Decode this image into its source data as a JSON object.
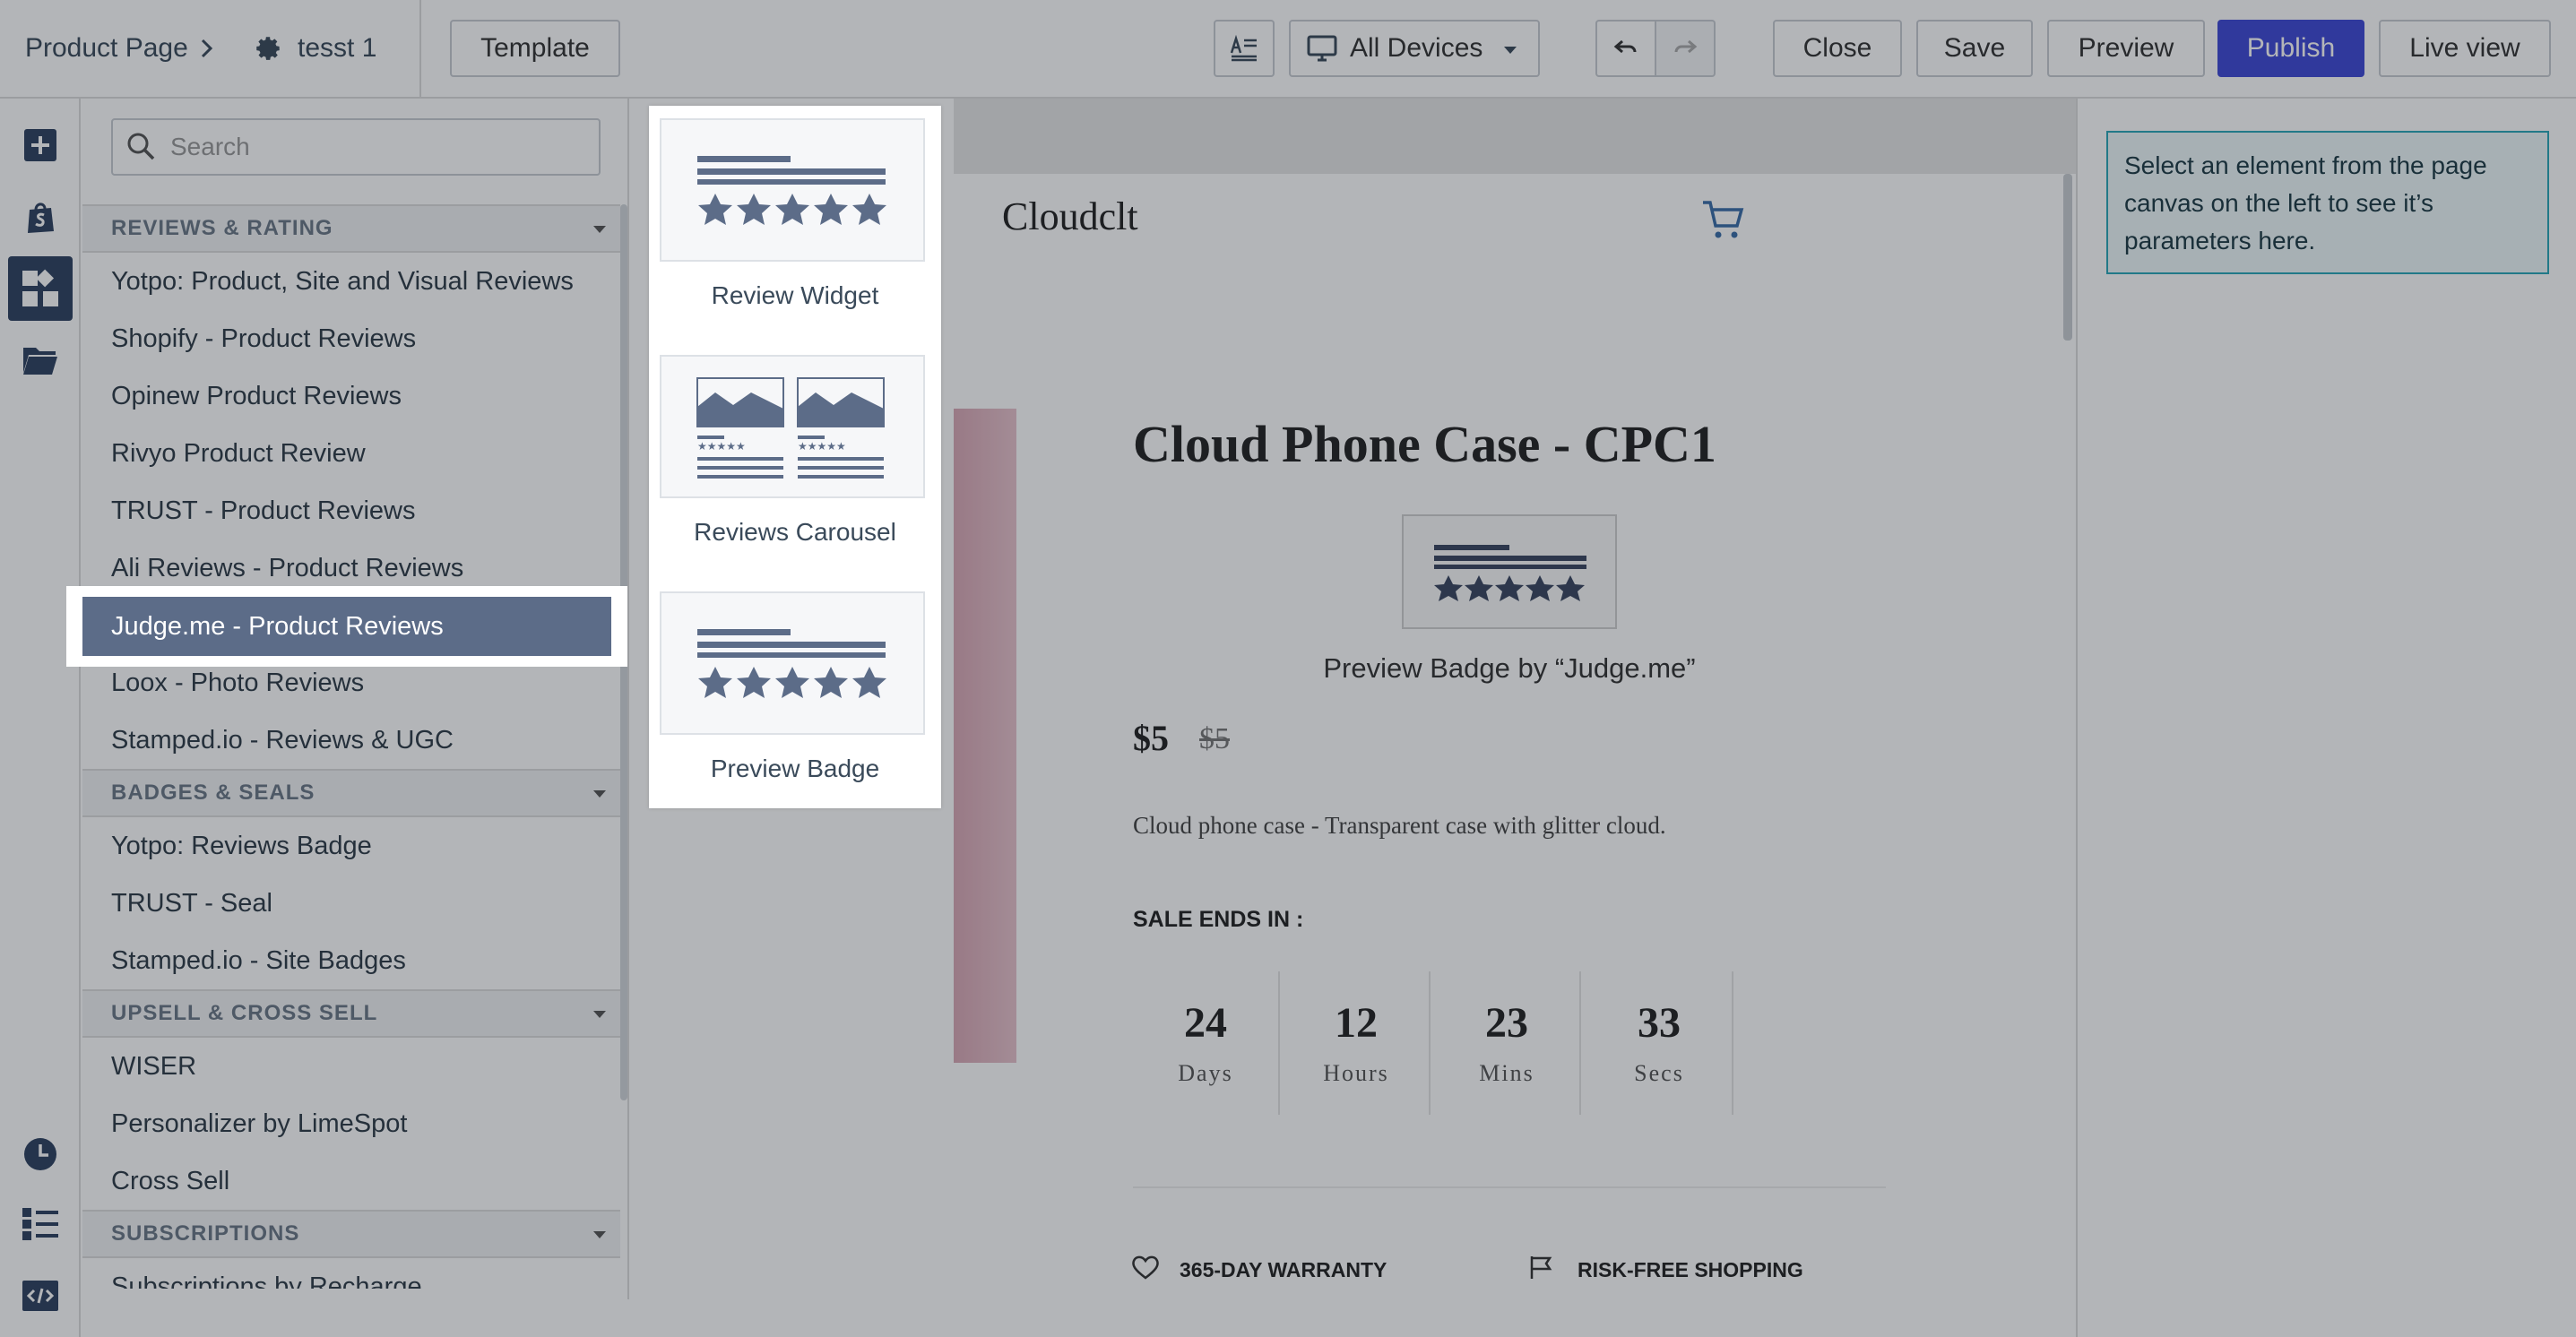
{
  "topbar": {
    "breadcrumb_root": "Product Page",
    "page_name": "tesst 1",
    "template_label": "Template",
    "devices_label": "All Devices",
    "close_label": "Close",
    "save_label": "Save",
    "preview_label": "Preview",
    "publish_label": "Publish",
    "liveview_label": "Live view"
  },
  "search": {
    "placeholder": "Search"
  },
  "sections": {
    "reviews": "REVIEWS & RATING",
    "badges": "BADGES & SEALS",
    "upsell": "UPSELL & CROSS SELL",
    "subs": "SUBSCRIPTIONS"
  },
  "reviews_items": [
    "Yotpo: Product, Site and Visual Reviews",
    "Shopify - Product Reviews",
    "Opinew Product Reviews",
    "Rivyo Product Review",
    "TRUST - Product Reviews",
    "Ali Reviews - Product Reviews",
    "Judge.me - Product Reviews",
    "Loox - Photo Reviews",
    "Stamped.io - Reviews & UGC"
  ],
  "badges_items": [
    "Yotpo: Reviews Badge",
    "TRUST - Seal",
    "Stamped.io - Site Badges"
  ],
  "upsell_items": [
    "WISER",
    "Personalizer by LimeSpot",
    "Cross Sell"
  ],
  "subs_items": [
    "Subscriptions by Recharge"
  ],
  "widgets": [
    "Review Widget",
    "Reviews Carousel",
    "Preview Badge"
  ],
  "canvas": {
    "store_name": "Cloudclt",
    "product_title": "Cloud Phone Case - CPC1",
    "badge_caption": "Preview Badge by “Judge.me”",
    "price": "$5",
    "compare_price": "$5",
    "description": "Cloud phone case - Transparent case with glitter cloud.",
    "sale_label": "SALE ENDS IN :",
    "countdown": [
      {
        "value": "24",
        "unit": "Days"
      },
      {
        "value": "12",
        "unit": "Hours"
      },
      {
        "value": "23",
        "unit": "Mins"
      },
      {
        "value": "33",
        "unit": "Secs"
      }
    ],
    "warranty": "365-DAY WARRANTY",
    "risk_free": "RISK-FREE SHOPPING"
  },
  "inspector": {
    "hint": "Select an element from the page canvas on the left to see it’s parameters here."
  },
  "colors": {
    "publish": "#3f49d6",
    "selected": "#5c6c88",
    "rail_active": "#2e4160",
    "hint_border": "#2aa7b8"
  }
}
